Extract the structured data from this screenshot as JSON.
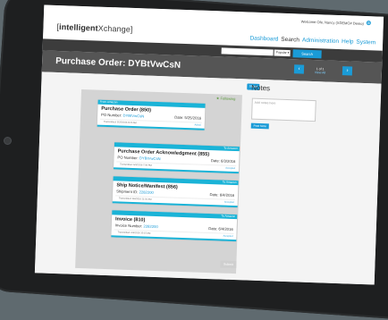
{
  "app": {
    "logo_left": "[",
    "logo_bold": "intelligent",
    "logo_rest": "Xchange",
    "logo_right": "]",
    "welcome": "Welcome Ofe, Nancy (XDEMO# Demo)"
  },
  "nav": [
    "Dashboard",
    "Search",
    "Administration",
    "Help",
    "System"
  ],
  "search": {
    "placeholder": "",
    "select_value": "Popular",
    "button": "Search"
  },
  "page": {
    "title": "Purchase Order: DYBtVwCsN"
  },
  "pager": {
    "prev": "‹",
    "next": "›",
    "count": "1 of 1",
    "link": "View All"
  },
  "actions": {
    "share": "Share",
    "following": "Following",
    "submit": "Submit"
  },
  "notes": {
    "title": "Notes",
    "placeholder": "Add notes here",
    "post": "Post Note"
  },
  "documents": [
    {
      "direction": "From Amazon",
      "title": "Purchase Order (850)",
      "ref_label": "PO Number:",
      "ref_value": "DYBtVwCsN",
      "date": "Date: 5/25/2016",
      "transmitted": "Transmitted: 5/25/2016 8:20 AM",
      "link": "Acked"
    },
    {
      "direction": "To Amazon",
      "title": "Purchase Order Acknowledgment (855)",
      "ref_label": "PO Number:",
      "ref_value": "DYBtVwCsN",
      "date": "Date: 6/3/2016",
      "transmitted": "Transmitted: 6/3/2016 7:09 PM",
      "link": "Accepted"
    },
    {
      "direction": "To Amazon",
      "title": "Ship Notice/Manifest (856)",
      "ref_label": "Shipment ID:",
      "ref_value": "2282200",
      "date": "Date: 6/4/2016",
      "transmitted": "Transmitted: 6/4/2016 11:02 AM",
      "link": "Accepted"
    },
    {
      "direction": "To Amazon",
      "title": "Invoice (810)",
      "ref_label": "Invoice Number:",
      "ref_value": "2282200",
      "date": "Date: 6/4/2016",
      "transmitted": "Transmitted: 6/4/2016 10:15 AM",
      "link": "Accepted"
    }
  ]
}
